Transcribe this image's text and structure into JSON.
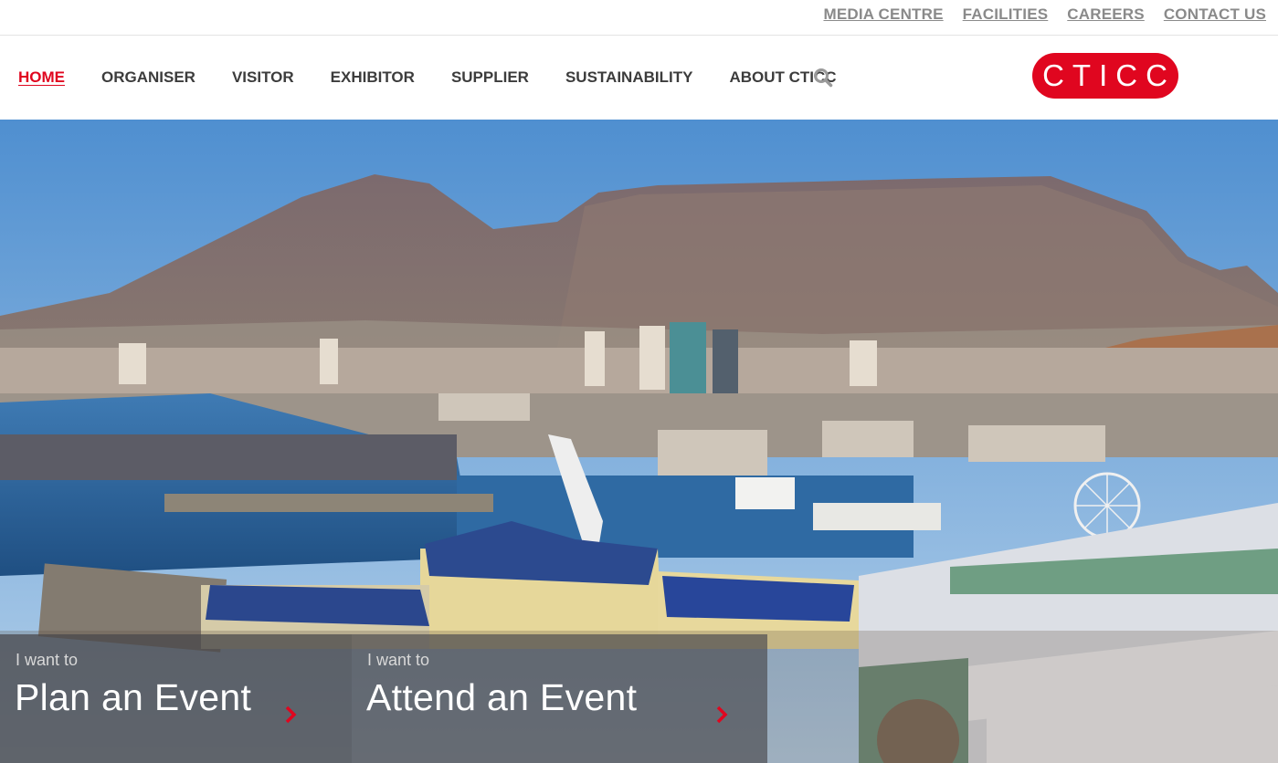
{
  "top_links": [
    "MEDIA CENTRE",
    "FACILITIES",
    "CAREERS",
    "CONTACT US"
  ],
  "nav": {
    "items": [
      "HOME",
      "ORGANISER",
      "VISITOR",
      "EXHIBITOR",
      "SUPPLIER",
      "SUSTAINABILITY",
      "ABOUT CTICC"
    ],
    "active": "HOME"
  },
  "logo": {
    "text": "CTICC"
  },
  "hero": {
    "image": "Cape Town waterfront with Table Mountain"
  },
  "cards": [
    {
      "pre": "I want to",
      "title": "Plan an Event"
    },
    {
      "pre": "I want to",
      "title": "Attend an Event"
    }
  ],
  "colors": {
    "brand_red": "#e0061f",
    "nav_text": "#3c3c3c",
    "top_link": "#8a8a8a"
  },
  "icons": {
    "search": "search-icon",
    "card_arrow": "chevron-right-icon"
  }
}
